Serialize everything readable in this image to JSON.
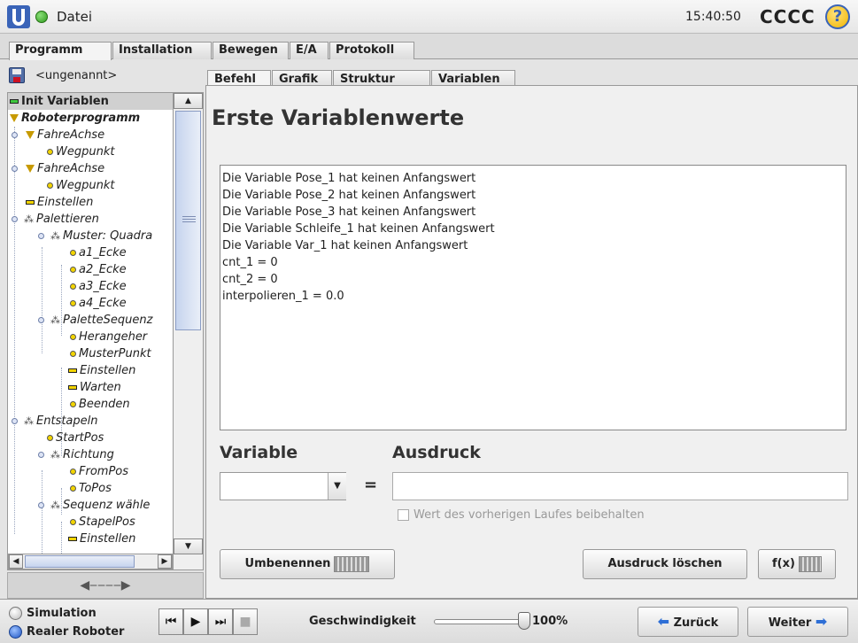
{
  "header": {
    "file_label": "Datei",
    "time": "15:40:50",
    "robot_name": "CCCC",
    "help_label": "?"
  },
  "top_tabs": [
    {
      "label": "Programm",
      "active": true
    },
    {
      "label": "Installation",
      "active": false
    },
    {
      "label": "Bewegen",
      "active": false
    },
    {
      "label": "E/A",
      "active": false
    },
    {
      "label": "Protokoll",
      "active": false
    }
  ],
  "program": {
    "name": "<ungenannt>"
  },
  "tree": [
    {
      "label": "Init Variablen",
      "icon": "bar-green-icon"
    },
    {
      "label": "Roboterprogramm",
      "icon": "triangle-icon"
    },
    {
      "label": "FahreAchse",
      "icon": "triangle-icon"
    },
    {
      "label": "Wegpunkt",
      "icon": "waypoint-dot-icon"
    },
    {
      "label": "FahreAchse",
      "icon": "triangle-icon"
    },
    {
      "label": "Wegpunkt",
      "icon": "waypoint-dot-icon"
    },
    {
      "label": "Einstellen",
      "icon": "bar-yellow-icon"
    },
    {
      "label": "Palettieren",
      "icon": "pallet-icon"
    },
    {
      "label": "Muster: Quadra",
      "icon": "pallet-icon"
    },
    {
      "label": "a1_Ecke",
      "icon": "waypoint-dot-icon"
    },
    {
      "label": "a2_Ecke",
      "icon": "waypoint-dot-icon"
    },
    {
      "label": "a3_Ecke",
      "icon": "waypoint-dot-icon"
    },
    {
      "label": "a4_Ecke",
      "icon": "waypoint-dot-icon"
    },
    {
      "label": "PaletteSequenz",
      "icon": "pallet-icon"
    },
    {
      "label": "Herangeher",
      "icon": "waypoint-dot-icon"
    },
    {
      "label": "MusterPunkt",
      "icon": "waypoint-dot-icon"
    },
    {
      "label": "Einstellen",
      "icon": "bar-yellow-icon"
    },
    {
      "label": "Warten",
      "icon": "bar-yellow-icon"
    },
    {
      "label": "Beenden",
      "icon": "waypoint-dot-icon"
    },
    {
      "label": "Entstapeln",
      "icon": "pallet-icon"
    },
    {
      "label": "StartPos",
      "icon": "waypoint-dot-icon"
    },
    {
      "label": "Richtung",
      "icon": "pallet-icon"
    },
    {
      "label": "FromPos",
      "icon": "waypoint-dot-icon"
    },
    {
      "label": "ToPos",
      "icon": "waypoint-dot-icon"
    },
    {
      "label": "Sequenz wähle",
      "icon": "pallet-icon"
    },
    {
      "label": "StapelPos",
      "icon": "waypoint-dot-icon"
    },
    {
      "label": "Einstellen",
      "icon": "bar-yellow-icon"
    }
  ],
  "sub_tabs": [
    {
      "label": "Befehl",
      "active": true
    },
    {
      "label": "Grafik",
      "active": false
    },
    {
      "label": "Struktur",
      "active": false
    },
    {
      "label": "Variablen",
      "active": false
    }
  ],
  "main": {
    "title": "Erste Variablenwerte",
    "messages": [
      "Die Variable Pose_1 hat keinen Anfangswert",
      "Die Variable Pose_2 hat keinen Anfangswert",
      "Die Variable Pose_3 hat keinen Anfangswert",
      "Die Variable Schleife_1 hat keinen Anfangswert",
      "Die Variable Var_1 hat keinen Anfangswert",
      "cnt_1 = 0",
      "cnt_2 = 0",
      "interpolieren_1 = 0.0"
    ],
    "variable_label": "Variable",
    "variable_value": "",
    "equals": "=",
    "expression_label": "Ausdruck",
    "expression_value": "",
    "keep_value_label": "Wert des vorherigen Laufes beibehalten",
    "rename_button": "Umbenennen",
    "clear_button": "Ausdruck löschen",
    "fx_button": "f(x)"
  },
  "footer": {
    "simulation_label": "Simulation",
    "real_robot_label": "Realer Roboter",
    "speed_label": "Geschwindigkeit",
    "speed_value": "100%",
    "speed_fraction": 1.0,
    "back_button": "Zurück",
    "next_button": "Weiter"
  },
  "colors": {
    "selection": "#d0d0d0",
    "accent_blue": "#2e6fd6",
    "status_green": "#3ec93e",
    "node_yellow": "#f2d400"
  }
}
